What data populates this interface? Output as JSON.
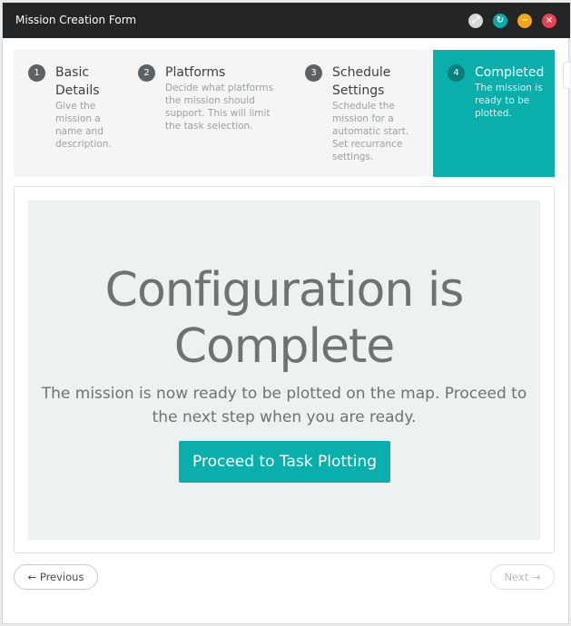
{
  "window": {
    "title": "Mission Creation Form",
    "controls": {
      "expand_glyph": "⤢",
      "refresh_glyph": "↻",
      "minimize_glyph": "−",
      "close_glyph": "×"
    }
  },
  "steps": [
    {
      "number": "1",
      "title": "Basic Details",
      "description": "Give the mission a name and description.",
      "active": false
    },
    {
      "number": "2",
      "title": "Platforms",
      "description": "Decide what platforms the mission should support. This will limit the task selection.",
      "active": false
    },
    {
      "number": "3",
      "title": "Schedule Settings",
      "description": "Schedule the mission for a automatic start. Set recurrance settings.",
      "active": false
    },
    {
      "number": "4",
      "title": "Completed",
      "description": "The mission is ready to be plotted.",
      "active": true
    }
  ],
  "content": {
    "heading": "Configuration is Complete",
    "message": "The mission is now ready to be plotted on the map. Proceed to the next step when you are ready.",
    "proceed_label": "Proceed to Task Plotting"
  },
  "navigation": {
    "previous_label": "← Previous",
    "next_label": "Next →"
  },
  "colors": {
    "accent": "#0aaeaa",
    "titlebar": "#232526",
    "minimize": "#f5a516",
    "close": "#e8424f"
  }
}
